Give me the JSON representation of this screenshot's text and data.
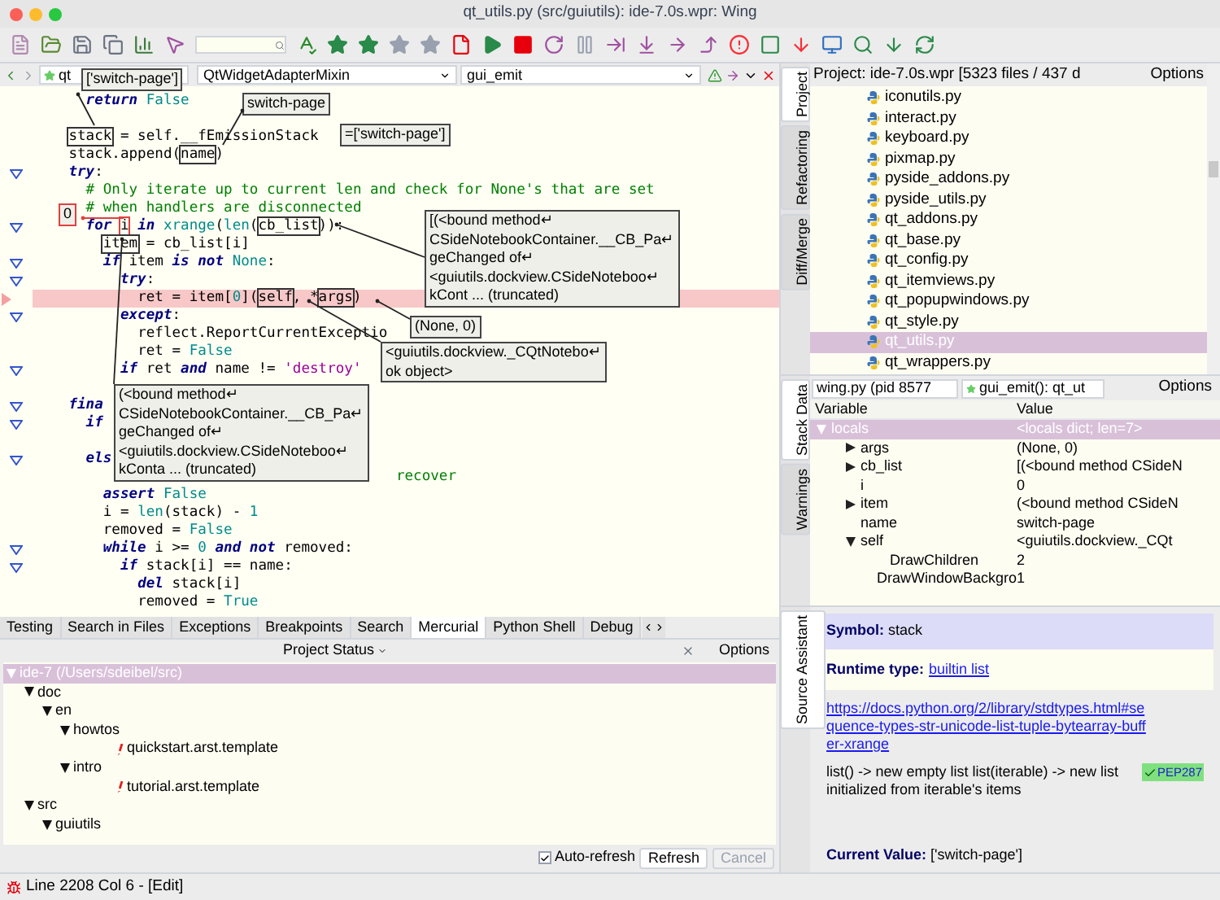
{
  "window": {
    "title": "qt_utils.py (src/guiutils): ide-7.0s.wpr: Wing"
  },
  "editor": {
    "file_menu": "qt",
    "class_menu": "QtWidgetAdapterMixin",
    "method_menu": "gui_emit",
    "lines": [
      {
        "fold": false,
        "highlighted": false,
        "tokens": [
          {
            "text": "      return",
            "kind": "kw"
          },
          {
            "text": " False",
            "kind": "bi"
          }
        ]
      },
      {
        "fold": false,
        "highlighted": false
      },
      {
        "fold": false,
        "highlighted": false,
        "tokens": [
          {
            "text": "    stack",
            "kind": "box"
          },
          {
            "text": " = self.__fEmissionStack",
            "kind": "p"
          }
        ]
      },
      {
        "fold": false,
        "highlighted": false,
        "tokens": [
          {
            "text": "    stack.append(",
            "kind": "p"
          },
          {
            "text": "name",
            "kind": "box"
          },
          {
            "text": ")",
            "kind": "p"
          }
        ]
      },
      {
        "fold": true,
        "highlighted": false,
        "tokens": [
          {
            "text": "    try",
            "kind": "kw"
          },
          {
            "text": ":",
            "kind": "p"
          }
        ]
      },
      {
        "fold": false,
        "highlighted": false,
        "tokens": [
          {
            "text": "      # Only iterate up to current len and check for None's that are set",
            "kind": "cmt"
          }
        ]
      },
      {
        "fold": false,
        "highlighted": false,
        "tokens": [
          {
            "text": "      # when handlers are disconnected",
            "kind": "cmt"
          }
        ]
      },
      {
        "fold": true,
        "highlighted": false,
        "tokens": [
          {
            "text": "      for ",
            "kind": "kw"
          },
          {
            "text": "i",
            "kind": "hbox"
          },
          {
            "text": " in ",
            "kind": "kw"
          },
          {
            "text": "xrange",
            "kind": "bi"
          },
          {
            "text": "(",
            "kind": "p"
          },
          {
            "text": "len",
            "kind": "bi"
          },
          {
            "text": "(",
            "kind": "p"
          },
          {
            "text": "cb_list",
            "kind": "box"
          },
          {
            "text": ")):",
            "kind": "p"
          }
        ]
      },
      {
        "fold": false,
        "highlighted": false,
        "tokens": [
          {
            "text": "        item",
            "kind": "box"
          },
          {
            "text": " = cb_list[i]",
            "kind": "p"
          }
        ]
      },
      {
        "fold": true,
        "highlighted": false,
        "tokens": [
          {
            "text": "        if",
            "kind": "kw"
          },
          {
            "text": " item ",
            "kind": "p"
          },
          {
            "text": "is not",
            "kind": "kw"
          },
          {
            "text": " None",
            "kind": "bi"
          },
          {
            "text": ":",
            "kind": "p"
          }
        ]
      },
      {
        "fold": true,
        "highlighted": false,
        "tokens": [
          {
            "text": "          try",
            "kind": "kw"
          },
          {
            "text": ":",
            "kind": "p"
          }
        ]
      },
      {
        "fold": false,
        "highlighted": true,
        "tokens": [
          {
            "text": "            ret = item[",
            "kind": "p"
          },
          {
            "text": "0",
            "kind": "bi"
          },
          {
            "text": "](",
            "kind": "p"
          },
          {
            "text": "self",
            "kind": "box"
          },
          {
            "text": ", *",
            "kind": "p"
          },
          {
            "text": "args",
            "kind": "box"
          },
          {
            "text": ")",
            "kind": "p"
          }
        ]
      },
      {
        "fold": true,
        "highlighted": false,
        "tokens": [
          {
            "text": "          except",
            "kind": "kw"
          },
          {
            "text": ":",
            "kind": "p"
          }
        ]
      },
      {
        "fold": false,
        "highlighted": false,
        "tokens": [
          {
            "text": "            reflect.ReportCurrentExceptio",
            "kind": "p"
          }
        ]
      },
      {
        "fold": false,
        "highlighted": false,
        "tokens": [
          {
            "text": "            ret = ",
            "kind": "p"
          },
          {
            "text": "False",
            "kind": "bi"
          }
        ]
      },
      {
        "fold": true,
        "highlighted": false,
        "tokens": [
          {
            "text": "          if",
            "kind": "kw"
          },
          {
            "text": " ret ",
            "kind": "p"
          },
          {
            "text": "and",
            "kind": "kw"
          },
          {
            "text": " name != ",
            "kind": "p"
          },
          {
            "text": "'destroy'",
            "kind": "str"
          }
        ]
      },
      {
        "fold": false,
        "highlighted": false
      },
      {
        "fold": true,
        "highlighted": false,
        "tokens": [
          {
            "text": "    fina",
            "kind": "kw"
          }
        ]
      },
      {
        "fold": true,
        "highlighted": false,
        "tokens": [
          {
            "text": "      if",
            "kind": "kw"
          }
        ]
      },
      {
        "fold": false,
        "highlighted": false
      },
      {
        "fold": true,
        "highlighted": false,
        "tokens": [
          {
            "text": "      els",
            "kind": "kw"
          }
        ]
      },
      {
        "fold": false,
        "highlighted": false,
        "tokens": [
          {
            "text": "                                          recover",
            "kind": "cmt"
          }
        ]
      },
      {
        "fold": false,
        "highlighted": false,
        "tokens": [
          {
            "text": "        assert",
            "kind": "kw"
          },
          {
            "text": " False",
            "kind": "bi"
          }
        ]
      },
      {
        "fold": false,
        "highlighted": false,
        "tokens": [
          {
            "text": "        i = ",
            "kind": "p"
          },
          {
            "text": "len",
            "kind": "bi"
          },
          {
            "text": "(stack) - ",
            "kind": "p"
          },
          {
            "text": "1",
            "kind": "bi"
          }
        ]
      },
      {
        "fold": false,
        "highlighted": false,
        "tokens": [
          {
            "text": "        removed = ",
            "kind": "p"
          },
          {
            "text": "False",
            "kind": "bi"
          }
        ]
      },
      {
        "fold": true,
        "highlighted": false,
        "tokens": [
          {
            "text": "        while",
            "kind": "kw"
          },
          {
            "text": " i >= ",
            "kind": "p"
          },
          {
            "text": "0",
            "kind": "bi"
          },
          {
            "text": " and not",
            "kind": "kw"
          },
          {
            "text": " removed:",
            "kind": "p"
          }
        ]
      },
      {
        "fold": true,
        "highlighted": false,
        "tokens": [
          {
            "text": "          if",
            "kind": "kw"
          },
          {
            "text": " stack[i] == name:",
            "kind": "p"
          }
        ]
      },
      {
        "fold": false,
        "highlighted": false,
        "tokens": [
          {
            "text": "            del",
            "kind": "kw"
          },
          {
            "text": " stack[i]",
            "kind": "p"
          }
        ]
      },
      {
        "fold": false,
        "highlighted": false,
        "tokens": [
          {
            "text": "            removed = ",
            "kind": "p"
          },
          {
            "text": "True",
            "kind": "bi"
          }
        ]
      }
    ],
    "tips": [
      {
        "kind": "value",
        "lines": [
          "['switch-page']"
        ]
      },
      {
        "kind": "value",
        "lines": [
          "switch-page"
        ]
      },
      {
        "kind": "value",
        "lines": [
          "=['switch-page']"
        ]
      },
      {
        "kind": "changed",
        "lines": [
          "0"
        ]
      },
      {
        "kind": "value",
        "lines": [
          "[(<bound method↵",
          "CSideNotebookContainer.__CB_Pa↵",
          "geChanged of↵",
          "<guiutils.dockview.CSideNoteboo↵",
          "kCont ... (truncated)"
        ]
      },
      {
        "kind": "value",
        "lines": [
          "(None, 0)"
        ]
      },
      {
        "kind": "value",
        "lines": [
          "<guiutils.dockview._CQtNotebo↵",
          "ok object>"
        ]
      },
      {
        "kind": "value",
        "lines": [
          "(<bound method↵",
          "CSideNotebookContainer.__CB_Pa↵",
          "geChanged of↵",
          "<guiutils.dockview.CSideNoteboo↵",
          "kConta ... (truncated)"
        ]
      }
    ]
  },
  "project": {
    "tabs": [
      {
        "label": "Project",
        "selected": true
      },
      {
        "label": "Refactoring",
        "selected": false
      },
      {
        "label": "Diff/Merge",
        "selected": false
      }
    ],
    "title": "Project: ide-7.0s.wpr [5323 files / 437 d",
    "options": "Options",
    "files": [
      {
        "name": "iconutils.py",
        "selected": false
      },
      {
        "name": "interact.py",
        "selected": false
      },
      {
        "name": "keyboard.py",
        "selected": false
      },
      {
        "name": "pixmap.py",
        "selected": false
      },
      {
        "name": "pyside_addons.py",
        "selected": false
      },
      {
        "name": "pyside_utils.py",
        "selected": false
      },
      {
        "name": "qt_addons.py",
        "selected": false
      },
      {
        "name": "qt_base.py",
        "selected": false
      },
      {
        "name": "qt_config.py",
        "selected": false
      },
      {
        "name": "qt_itemviews.py",
        "selected": false
      },
      {
        "name": "qt_popupwindows.py",
        "selected": false
      },
      {
        "name": "qt_style.py",
        "selected": false
      },
      {
        "name": "qt_utils.py",
        "selected": true
      },
      {
        "name": "qt_wrappers.py",
        "selected": false
      }
    ]
  },
  "stack_data": {
    "tabs": [
      {
        "label": "Stack Data",
        "selected": true
      },
      {
        "label": "Warnings",
        "selected": false
      }
    ],
    "process": "wing.py (pid 8577",
    "frame": "gui_emit(): qt_ut",
    "options": "Options",
    "columns": [
      "Variable",
      "Value"
    ],
    "rows": [
      {
        "name": "locals",
        "value": "<locals dict; len=7>",
        "expanded": true,
        "selected": true,
        "children": [
          {
            "name": "args",
            "value": "(None, 0)",
            "expanded": false,
            "selected": false
          },
          {
            "name": "cb_list",
            "value": "[(<bound method CSideN",
            "expanded": false,
            "selected": false
          },
          {
            "name": "i",
            "value": "0",
            "selected": false
          },
          {
            "name": "item",
            "value": "(<bound method CSideN",
            "expanded": false,
            "selected": false
          },
          {
            "name": "name",
            "value": "switch-page",
            "selected": false
          },
          {
            "name": "self",
            "value": "<guiutils.dockview._CQt",
            "expanded": true,
            "selected": false,
            "children": [
              {
                "name": "DrawChildren",
                "value": "2",
                "selected": false
              },
              {
                "name": "DrawWindowBackgro",
                "value": "1",
                "selected": false
              }
            ]
          }
        ]
      }
    ]
  },
  "source_assistant": {
    "tab": "Source Assistant",
    "symbol_label": "Symbol:",
    "symbol": "stack",
    "runtime_label": "Runtime type:",
    "runtime_link": "builtin list",
    "doc_link": "https://docs.python.org/2/library/stdtypes.html#sequence-types-str-unicode-list-tuple-bytearray-buffer-xrange",
    "description": "list() -> new empty list list(iterable) -> new list initialized from iterable's items",
    "badge": "PEP287",
    "value_label": "Current Value:",
    "value": "['switch-page']"
  },
  "tools": {
    "tabs": [
      {
        "label": "Testing",
        "selected": false
      },
      {
        "label": "Search in Files",
        "selected": false
      },
      {
        "label": "Exceptions",
        "selected": false
      },
      {
        "label": "Breakpoints",
        "selected": false
      },
      {
        "label": "Search",
        "selected": false
      },
      {
        "label": "Mercurial",
        "selected": true
      },
      {
        "label": "Python Shell",
        "selected": false
      },
      {
        "label": "Debug",
        "selected": false
      }
    ],
    "view": "Project Status",
    "options": "Options",
    "tree": [
      {
        "kind": "folder",
        "name": "ide-7 (/Users/sdeibel/src)",
        "selected": true,
        "children": [
          {
            "kind": "folder",
            "name": "doc",
            "selected": false,
            "children": [
              {
                "kind": "folder",
                "name": "en",
                "selected": false,
                "children": [
                  {
                    "kind": "folder",
                    "name": "howtos",
                    "selected": false,
                    "children": [
                      {
                        "kind": "file",
                        "name": "quickstart.arst.template",
                        "selected": false
                      }
                    ]
                  },
                  {
                    "kind": "folder",
                    "name": "intro",
                    "selected": false,
                    "children": [
                      {
                        "kind": "file",
                        "name": "tutorial.arst.template",
                        "selected": false
                      }
                    ]
                  }
                ]
              }
            ]
          },
          {
            "kind": "folder",
            "name": "src",
            "selected": false,
            "children": [
              {
                "kind": "folder",
                "name": "guiutils",
                "selected": false
              }
            ]
          }
        ]
      }
    ],
    "auto_refresh": {
      "label": "Auto-refresh",
      "checked": true
    },
    "refresh": "Refresh",
    "cancel": {
      "label": "Cancel",
      "disabled": true
    }
  },
  "status_bar": {
    "text": "Line 2208 Col 6 - [Edit]"
  }
}
